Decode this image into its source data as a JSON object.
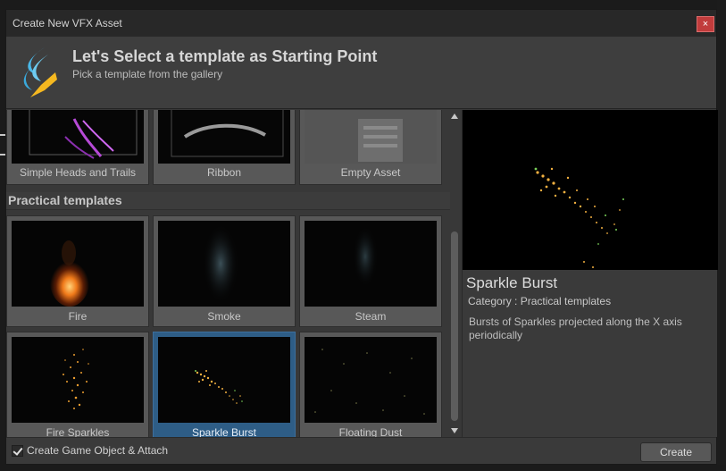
{
  "window": {
    "title": "Create New VFX Asset",
    "close_glyph": "×"
  },
  "header": {
    "title": "Let's Select a template as Starting Point",
    "subtitle": "Pick a template from the gallery"
  },
  "gallery": {
    "top_row": [
      {
        "label": "Simple Heads and Trails"
      },
      {
        "label": "Ribbon"
      },
      {
        "label": "Empty Asset"
      }
    ],
    "section_title": "Practical templates",
    "practical": [
      {
        "label": "Fire"
      },
      {
        "label": "Smoke"
      },
      {
        "label": "Steam"
      },
      {
        "label": "Fire Sparkles"
      },
      {
        "label": "Sparkle Burst",
        "selected": true
      },
      {
        "label": "Floating Dust"
      }
    ]
  },
  "preview": {
    "title": "Sparkle Burst",
    "category": "Category : Practical templates",
    "description": "Bursts of Sparkles projected along the X axis periodically"
  },
  "footer": {
    "checkbox_label": "Create Game Object & Attach",
    "checkbox_checked": true,
    "create_button": "Create"
  },
  "colors": {
    "selected_tile": "#2e5d86",
    "close_button": "#c13c3c",
    "logo_blue": "#4ab8e8",
    "logo_yellow": "#f5b820"
  },
  "icons": [
    "vfx-graph-logo-icon",
    "close-icon",
    "checkmark-icon",
    "scroll-up-icon",
    "scroll-down-icon"
  ]
}
